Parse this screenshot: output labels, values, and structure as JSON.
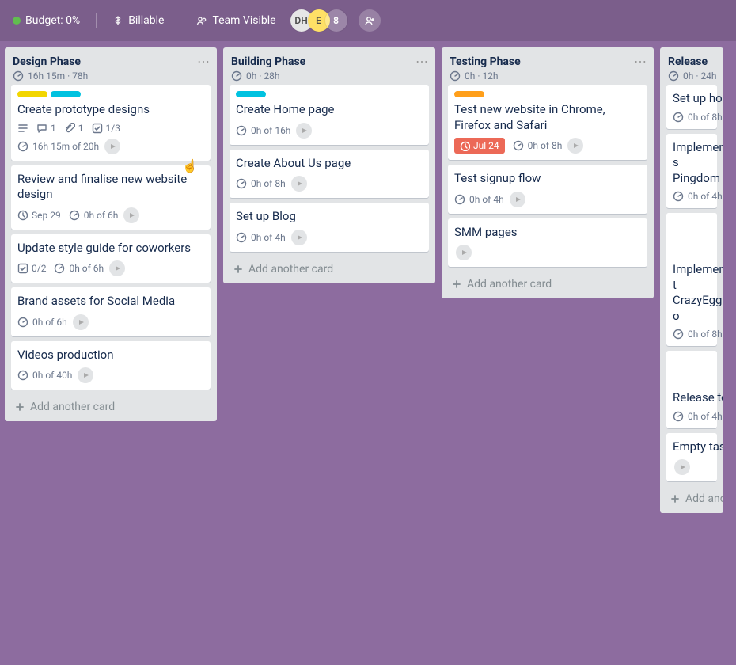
{
  "header": {
    "budget_label": "Budget: 0%",
    "billable_label": "Billable",
    "visibility_label": "Team Visible",
    "avatars": {
      "dh": "DH",
      "e": "E",
      "count": "8"
    }
  },
  "lists": {
    "design": {
      "title": "Design Phase",
      "sub": "16h 15m · 78h",
      "cards": {
        "c0": {
          "title": "Create prototype designs",
          "comments": "1",
          "attachments": "1",
          "checklist": "1/3",
          "time": "16h 15m of 20h"
        },
        "c1": {
          "title": "Review and finalise new website design",
          "due": "Sep 29",
          "time": "0h of 6h"
        },
        "c2": {
          "title": "Update style guide for coworkers",
          "checklist": "0/2",
          "time": "0h of 6h"
        },
        "c3": {
          "title": "Brand assets for Social Media",
          "time": "0h of 6h"
        },
        "c4": {
          "title": "Videos production",
          "time": "0h of 40h"
        }
      },
      "add": "Add another card"
    },
    "building": {
      "title": "Building Phase",
      "sub": "0h · 28h",
      "cards": {
        "c0": {
          "title": "Create Home page",
          "time": "0h of 16h"
        },
        "c1": {
          "title": "Create About Us page",
          "time": "0h of 8h"
        },
        "c2": {
          "title": "Set up Blog",
          "time": "0h of 4h"
        }
      },
      "add": "Add another card"
    },
    "testing": {
      "title": "Testing Phase",
      "sub": "0h · 12h",
      "cards": {
        "c0": {
          "title": "Test new website in Chrome, Firefox and Safari",
          "due": "Jul 24",
          "time": "0h of 8h"
        },
        "c1": {
          "title": "Test signup flow",
          "time": "0h of 4h"
        },
        "c2": {
          "title": "SMM pages"
        }
      },
      "add": "Add another card"
    },
    "release": {
      "title": "Release",
      "sub": "0h · 24h",
      "cards": {
        "c0": {
          "title": "Set up host",
          "time": "0h of 8h"
        },
        "c1": {
          "title": "Implement s Pingdom",
          "time": "0h of 4h"
        },
        "c2": {
          "title": "Implement t CrazyEgg o",
          "time": "0h of 8h"
        },
        "c3": {
          "title": "Release to c",
          "time": "0h of 4h"
        },
        "c4": {
          "title": "Empty task"
        }
      },
      "add": "Add anoth"
    }
  }
}
